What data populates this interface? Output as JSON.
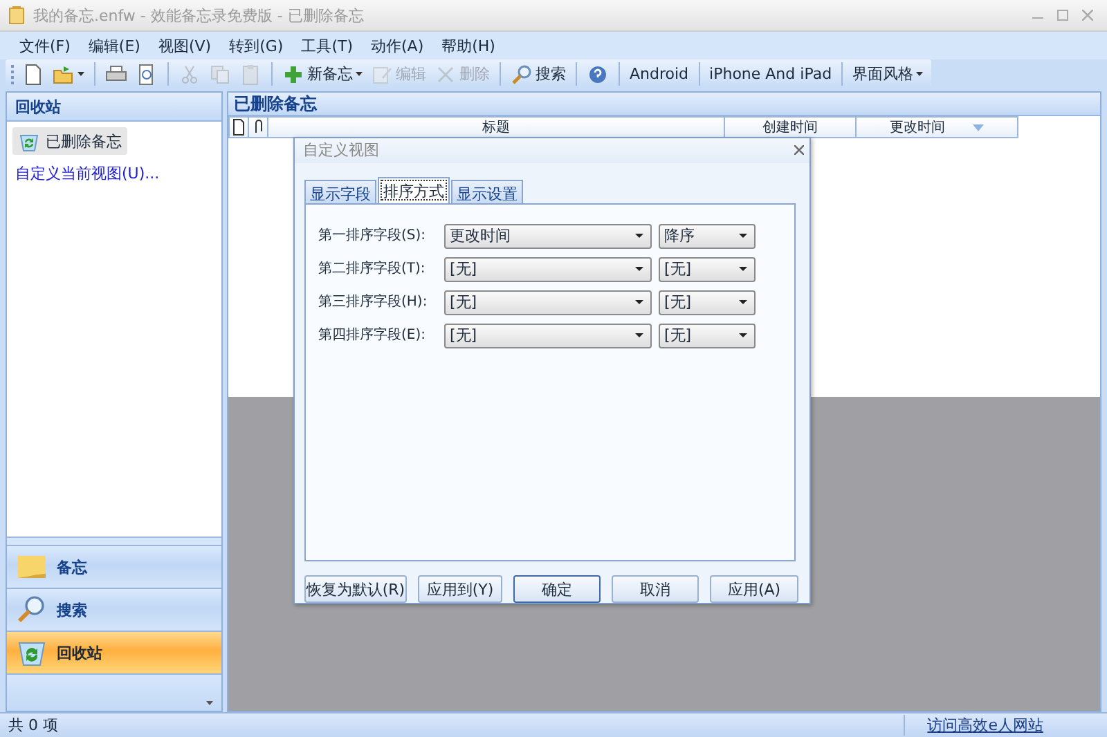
{
  "window": {
    "title": "我的备忘.enfw - 效能备忘录免费版 - 已删除备忘"
  },
  "menu": [
    "文件(F)",
    "编辑(E)",
    "视图(V)",
    "转到(G)",
    "工具(T)",
    "动作(A)",
    "帮助(H)"
  ],
  "toolbar": [
    {
      "kind": "icon",
      "disabled": false,
      "dropdown": false
    },
    {
      "kind": "icon",
      "disabled": false,
      "dropdown": true
    },
    {
      "kind": "separator"
    },
    {
      "kind": "icon",
      "disabled": false,
      "dropdown": false
    },
    {
      "kind": "icon",
      "disabled": false,
      "dropdown": false
    },
    {
      "kind": "separator"
    },
    {
      "kind": "icon",
      "disabled": true,
      "dropdown": false
    },
    {
      "kind": "icon",
      "disabled": true,
      "dropdown": false
    },
    {
      "kind": "icon",
      "disabled": true,
      "dropdown": false
    },
    {
      "kind": "separator"
    },
    {
      "kind": "icon-button",
      "label": "新备忘",
      "disabled": false,
      "dropdown": true
    },
    {
      "kind": "icon-button",
      "label": "编辑",
      "disabled": true,
      "dropdown": false
    },
    {
      "kind": "icon-button",
      "label": "删除",
      "disabled": true,
      "dropdown": false
    },
    {
      "kind": "separator"
    },
    {
      "kind": "icon-button",
      "label": "搜索",
      "disabled": false,
      "dropdown": false
    },
    {
      "kind": "separator"
    },
    {
      "kind": "icon",
      "disabled": false,
      "dropdown": false
    },
    {
      "kind": "separator"
    },
    {
      "kind": "text-button",
      "label": "Android",
      "disabled": false,
      "dropdown": false
    },
    {
      "kind": "separator"
    },
    {
      "kind": "text-button",
      "label": "iPhone And iPad",
      "disabled": false,
      "dropdown": false
    },
    {
      "kind": "separator"
    },
    {
      "kind": "text-button",
      "label": "界面风格",
      "disabled": false,
      "dropdown": true
    }
  ],
  "sidebar": {
    "title": "回收站",
    "items": [
      {
        "label": "已删除备忘",
        "selected": true
      }
    ],
    "link": "自定义当前视图(U)...",
    "nav": [
      {
        "label": "备忘",
        "selected": false
      },
      {
        "label": "搜索",
        "selected": false
      },
      {
        "label": "回收站",
        "selected": true
      }
    ]
  },
  "list": {
    "title": "已删除备忘",
    "columns": [
      {
        "kind": "icon"
      },
      {
        "kind": "icon"
      },
      {
        "kind": "text",
        "label": "标题",
        "sorted": false
      },
      {
        "kind": "text",
        "label": "创建时间",
        "sorted": false
      },
      {
        "kind": "text",
        "label": "更改时间",
        "sorted": true
      }
    ]
  },
  "dialog": {
    "title": "自定义视图",
    "tabs": [
      {
        "label": "显示字段",
        "selected": false
      },
      {
        "label": "排序方式",
        "selected": true
      },
      {
        "label": "显示设置",
        "selected": false
      }
    ],
    "rows": [
      {
        "label": "第一排序字段(S):",
        "field": "更改时间",
        "order": "降序"
      },
      {
        "label": "第二排序字段(T):",
        "field": "[无]",
        "order": "[无]"
      },
      {
        "label": "第三排序字段(H):",
        "field": "[无]",
        "order": "[无]"
      },
      {
        "label": "第四排序字段(E):",
        "field": "[无]",
        "order": "[无]"
      }
    ],
    "buttons": [
      {
        "label": "恢复为默认(R)",
        "default": false
      },
      {
        "label": "应用到(Y)",
        "default": false
      },
      {
        "label": "确定",
        "default": true
      },
      {
        "label": "取消",
        "default": false
      },
      {
        "label": "应用(A)",
        "default": false
      }
    ]
  },
  "status_bar": {
    "count": "共 0 项",
    "link": "访问高效e人网站"
  }
}
